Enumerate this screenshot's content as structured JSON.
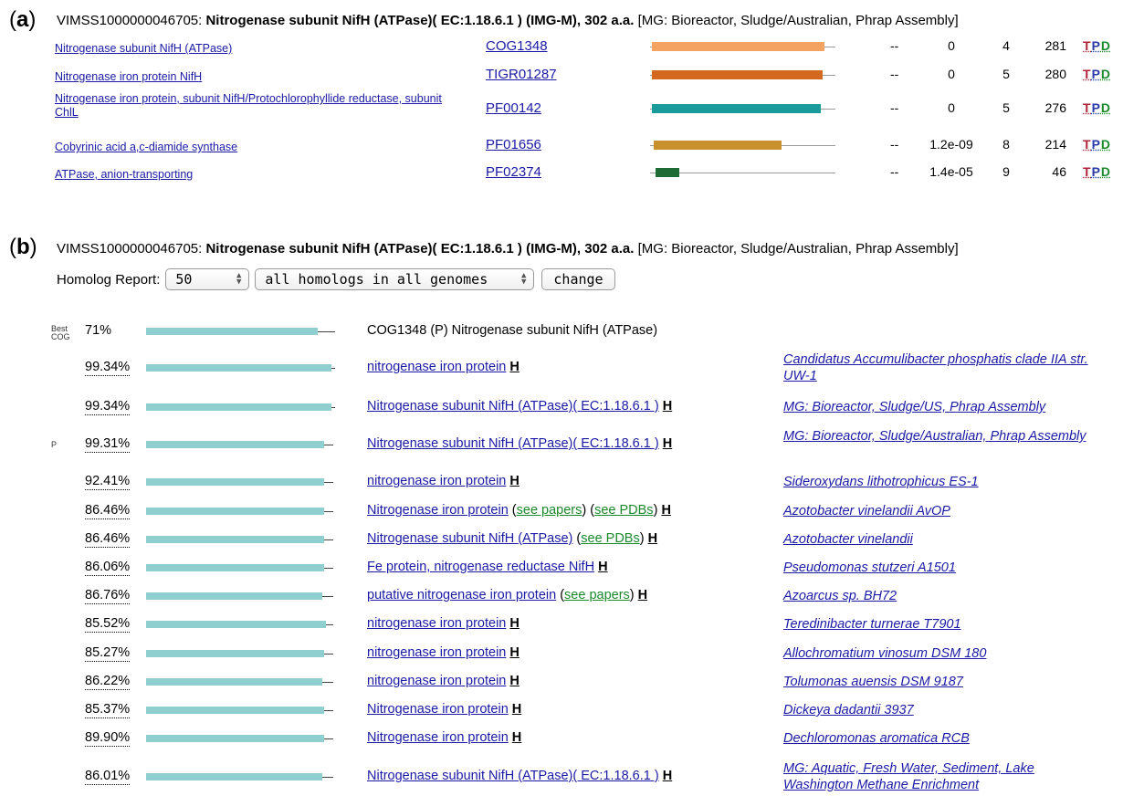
{
  "panel_a": {
    "label": "a",
    "header": {
      "gene_id": "VIMSS1000000046705:",
      "gene_bold": "Nitrogenase subunit NifH (ATPase)( EC:1.18.6.1 ) (IMG-M), 302 a.a.",
      "origin": "[MG: Bioreactor, Sludge/Australian, Phrap Assembly]"
    },
    "rows": [
      {
        "desc": "Nitrogenase subunit NifH (ATPase)",
        "family": "COG1348",
        "dash": "--",
        "evalue": "0",
        "n1": "4",
        "n2": "281",
        "t": "T",
        "p": "P",
        "d": "D",
        "color": "#f4a460",
        "start": 0.01,
        "end": 0.94
      },
      {
        "desc": "Nitrogenase iron protein NifH",
        "family": "TIGR01287",
        "dash": "--",
        "evalue": "0",
        "n1": "5",
        "n2": "280",
        "t": "T",
        "p": "P",
        "d": "D",
        "color": "#d2691e",
        "start": 0.01,
        "end": 0.93
      },
      {
        "desc": "Nitrogenase iron protein, subunit NifH/Protochlorophyllide reductase, subunit ChlL",
        "family": "PF00142",
        "dash": "--",
        "evalue": "0",
        "n1": "5",
        "n2": "276",
        "t": "T",
        "p": "P",
        "d": "D",
        "color": "#1a9a9a",
        "start": 0.01,
        "end": 0.92
      },
      {
        "desc": "Cobyrinic acid a,c-diamide synthase",
        "family": "PF01656",
        "dash": "--",
        "evalue": "1.2e-09",
        "n1": "8",
        "n2": "214",
        "t": "T",
        "p": "P",
        "d": "D",
        "color": "#c8912d",
        "start": 0.02,
        "end": 0.71
      },
      {
        "desc": "ATPase, anion-transporting",
        "family": "PF02374",
        "dash": "--",
        "evalue": "1.4e-05",
        "n1": "9",
        "n2": "46",
        "t": "T",
        "p": "P",
        "d": "D",
        "color": "#1e6b35",
        "start": 0.03,
        "end": 0.16
      }
    ]
  },
  "panel_b": {
    "label": "b",
    "header": {
      "gene_id": "VIMSS1000000046705:",
      "gene_bold": "Nitrogenase subunit NifH (ATPase)( EC:1.18.6.1 ) (IMG-M), 302 a.a.",
      "origin": "[MG: Bioreactor, Sludge/Australian, Phrap Assembly]"
    },
    "controls": {
      "label": "Homolog Report:",
      "count_value": "50",
      "scope_value": "all homologs in all genomes",
      "change_label": "change"
    },
    "best_cog": {
      "tag_line1": "Best",
      "tag_line2": "COG",
      "pct": "71%",
      "title": "COG1348 (P) Nitrogenase subunit NifH (ATPase)",
      "fill": 0.91,
      "tail_end": 0.98
    },
    "homologs": [
      {
        "tag": "",
        "pct": "99.34%",
        "title": "nitrogenase iron protein",
        "papers": "",
        "pdbs": "",
        "h": "H",
        "org": "Candidatus Accumulibacter phosphatis clade IIA str. UW-1",
        "fill": 0.98,
        "tail_end": 0.98
      },
      {
        "tag": "",
        "pct": "99.34%",
        "title": "Nitrogenase subunit NifH (ATPase)( EC:1.18.6.1 )",
        "papers": "",
        "pdbs": "",
        "h": "H",
        "org": "MG: Bioreactor, Sludge/US, Phrap Assembly",
        "fill": 0.98,
        "tail_end": 0.98
      },
      {
        "tag": "P",
        "pct": "99.31%",
        "title": "Nitrogenase subunit NifH (ATPase)( EC:1.18.6.1 )",
        "papers": "",
        "pdbs": "",
        "h": "H",
        "org": "MG: Bioreactor, Sludge/Australian, Phrap Assembly",
        "fill": 0.94,
        "tail_end": 0.97
      },
      {
        "tag": "",
        "pct": "92.41%",
        "title": "nitrogenase iron protein",
        "papers": "",
        "pdbs": "",
        "h": "H",
        "org": "Sideroxydans lithotrophicus ES-1",
        "fill": 0.94,
        "tail_end": 0.97
      },
      {
        "tag": "",
        "pct": "86.46%",
        "title": "Nitrogenase iron protein",
        "papers": "see papers",
        "pdbs": "see PDBs",
        "h": "H",
        "org": "Azotobacter vinelandii AvOP",
        "fill": 0.94,
        "tail_end": 0.97
      },
      {
        "tag": "",
        "pct": "86.46%",
        "title": "Nitrogenase subunit NifH (ATPase)",
        "papers": "",
        "pdbs": "see PDBs",
        "h": "H",
        "org": "Azotobacter vinelandii",
        "fill": 0.94,
        "tail_end": 0.97
      },
      {
        "tag": "",
        "pct": "86.06%",
        "title": "Fe protein, nitrogenase reductase NifH",
        "papers": "",
        "pdbs": "",
        "h": "H",
        "org": "Pseudomonas stutzeri A1501",
        "fill": 0.94,
        "tail_end": 0.97
      },
      {
        "tag": "",
        "pct": "86.76%",
        "title": "putative nitrogenase iron protein",
        "papers": "see papers",
        "pdbs": "",
        "h": "H",
        "org": "Azoarcus sp. BH72",
        "fill": 0.93,
        "tail_end": 0.97
      },
      {
        "tag": "",
        "pct": "85.52%",
        "title": "nitrogenase iron protein",
        "papers": "",
        "pdbs": "",
        "h": "H",
        "org": "Teredinibacter turnerae T7901",
        "fill": 0.95,
        "tail_end": 0.97
      },
      {
        "tag": "",
        "pct": "85.27%",
        "title": "nitrogenase iron protein",
        "papers": "",
        "pdbs": "",
        "h": "H",
        "org": "Allochromatium vinosum DSM 180",
        "fill": 0.94,
        "tail_end": 0.97
      },
      {
        "tag": "",
        "pct": "86.22%",
        "title": "nitrogenase iron protein",
        "papers": "",
        "pdbs": "",
        "h": "H",
        "org": "Tolumonas auensis DSM 9187",
        "fill": 0.93,
        "tail_end": 0.97
      },
      {
        "tag": "",
        "pct": "85.37%",
        "title": "Nitrogenase iron protein",
        "papers": "",
        "pdbs": "",
        "h": "H",
        "org": "Dickeya dadantii 3937",
        "fill": 0.94,
        "tail_end": 0.97
      },
      {
        "tag": "",
        "pct": "89.90%",
        "title": "Nitrogenase iron protein",
        "papers": "",
        "pdbs": "",
        "h": "H",
        "org": "Dechloromonas aromatica RCB",
        "fill": 0.94,
        "tail_end": 0.97
      },
      {
        "tag": "",
        "pct": "86.01%",
        "title": "Nitrogenase subunit NifH (ATPase)( EC:1.18.6.1 )",
        "papers": "",
        "pdbs": "",
        "h": "H",
        "org": "MG: Aquatic, Fresh Water, Sediment, Lake Washington Methane Enrichment",
        "fill": 0.93,
        "tail_end": 0.97
      }
    ]
  }
}
